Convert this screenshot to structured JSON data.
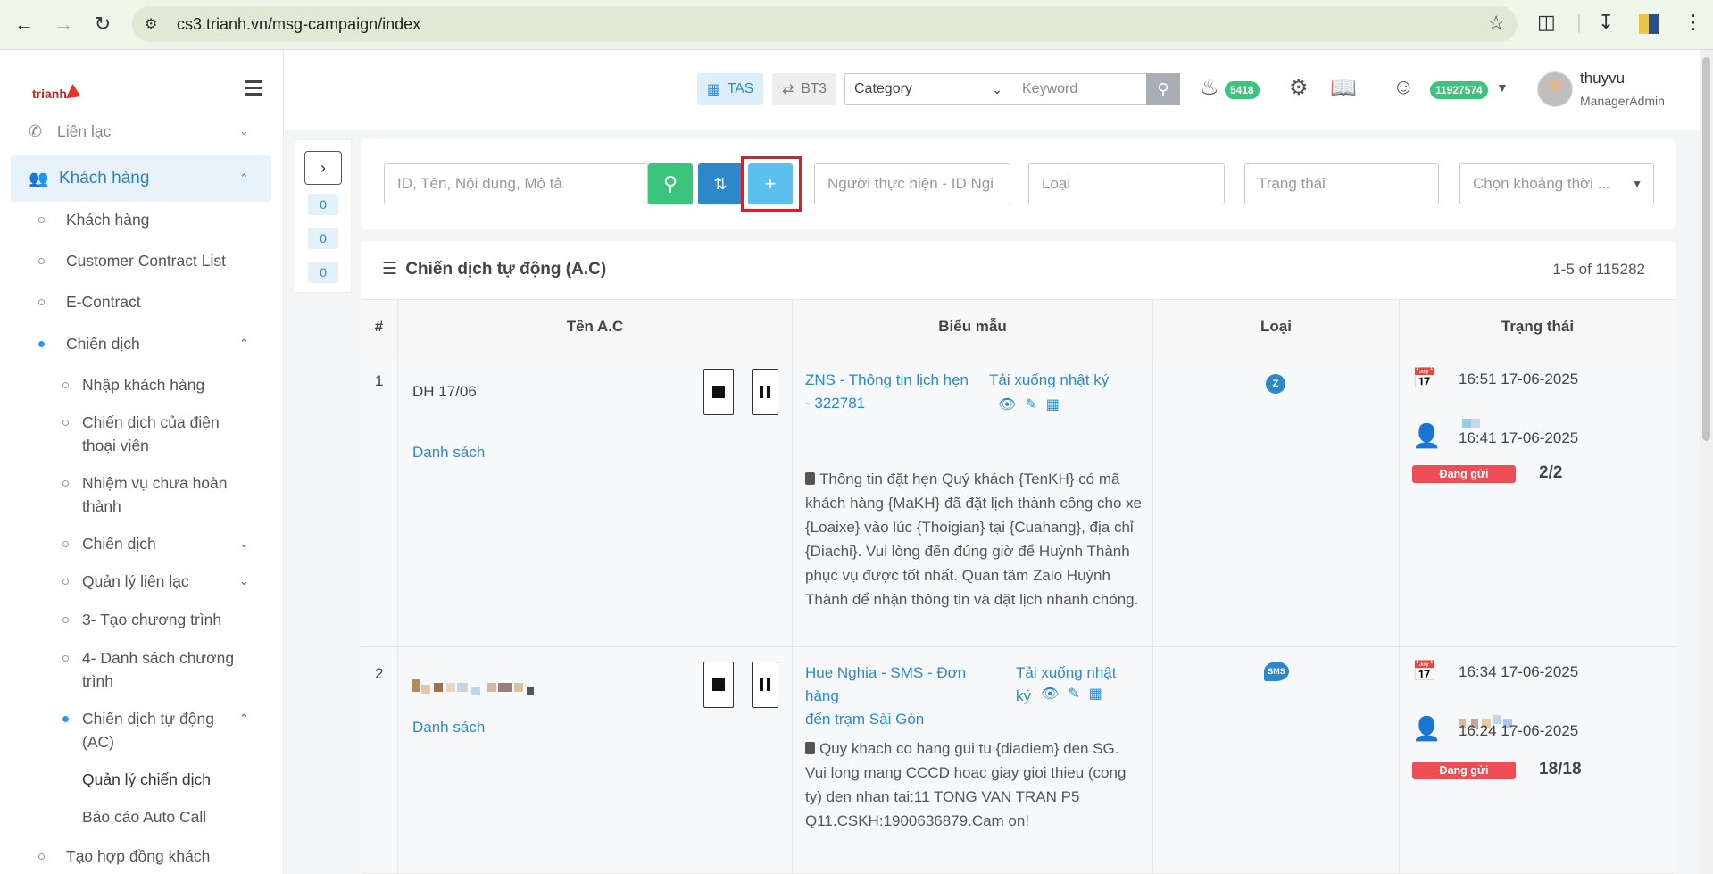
{
  "browser": {
    "url": "cs3.trianh.vn/msg-campaign/index"
  },
  "sidebar": {
    "logo_text": "trianh",
    "top_partial": "Liên lạc",
    "active_group": "Khách hàng",
    "items": [
      {
        "label": "Khách hàng"
      },
      {
        "label": "Customer Contract List"
      },
      {
        "label": "E-Contract"
      },
      {
        "label": "Chiến dịch"
      },
      {
        "label": "Nhập khách hàng"
      },
      {
        "label": "Chiến dịch của điện",
        "label2": "thoại viên"
      },
      {
        "label": "Nhiệm vụ chưa hoàn",
        "label2": "thành"
      },
      {
        "label": "Chiến dịch"
      },
      {
        "label": "Quản lý liên lạc"
      },
      {
        "label": "3- Tạo chương trình"
      },
      {
        "label": "4- Danh sách chương",
        "label2": "trình"
      },
      {
        "label": "Chiến dịch tự động",
        "label2": "(AC)"
      },
      {
        "label": "Quản lý chiến dịch"
      },
      {
        "label": "Báo cáo Auto Call"
      },
      {
        "label": "Tạo hợp đồng khách"
      }
    ]
  },
  "header": {
    "tas_label": "TAS",
    "bt3_label": "BT3",
    "category_label": "Category",
    "keyword_placeholder": "Keyword",
    "notif_count": "5418",
    "balance": "11927574",
    "user_name": "thuyvu",
    "user_role": "ManagerAdmin"
  },
  "counters": [
    "0",
    "0",
    "0"
  ],
  "filters": {
    "search_placeholder": "ID, Tên, Nội dung, Mô tả",
    "performer_placeholder": "Người thực hiện - ID Ngi",
    "type_placeholder": "Loại",
    "status_placeholder": "Trạng thái",
    "time_placeholder": "Chọn khoảng thời ..."
  },
  "card": {
    "title": "Chiến dịch tự động (A.C)",
    "pager": "1-5 of 115282"
  },
  "table": {
    "columns": [
      "#",
      "Tên A.C",
      "Biểu mẫu",
      "Loại",
      "Trạng thái"
    ],
    "rows": [
      {
        "num": "1",
        "name": "DH 17/06",
        "list_link": "Danh sách",
        "template_link_1": "ZNS - Thông tin lịch hẹn",
        "template_link_2": "- 322781",
        "download_1": "Tải xuống nhật ký",
        "download_2": "",
        "desc": "Thông tin đặt hẹn Quý khách {TenKH} có mã khách hàng {MaKH} đã đặt lịch thành công cho xe {Loaixe} vào lúc {Thoigian} tại {Cuahang}, địa chỉ {Diachi}. Vui lòng đến đúng giờ để Huỳnh Thành phục vụ được tốt nhất. Quan tâm Zalo Huỳnh Thành để nhận thông tin và đặt lịch nhanh chóng.",
        "type_icon": "Z",
        "time_scheduled": "16:51 17-06-2025",
        "time_created": "16:41 17-06-2025",
        "status": "Đang gửi",
        "progress": "2/2"
      },
      {
        "num": "2",
        "name": "",
        "list_link": "Danh sách",
        "template_link_1": "Hue Nghia - SMS - Đơn hàng",
        "template_link_2": "đến trạm Sài Gòn",
        "download_1": "Tải xuống nhật",
        "download_2": "ký",
        "desc": "Quy khach co hang gui tu {diadiem} den SG. Vui long mang CCCD hoac giay gioi thieu (cong ty) den nhan tai:11 TONG VAN TRAN P5 Q11.CSKH:1900636879.Cam on!",
        "type_icon": "SMS",
        "time_scheduled": "16:34 17-06-2025",
        "time_created": "16:24 17-06-2025",
        "status": "Đang gửi",
        "progress": "18/18"
      }
    ]
  }
}
